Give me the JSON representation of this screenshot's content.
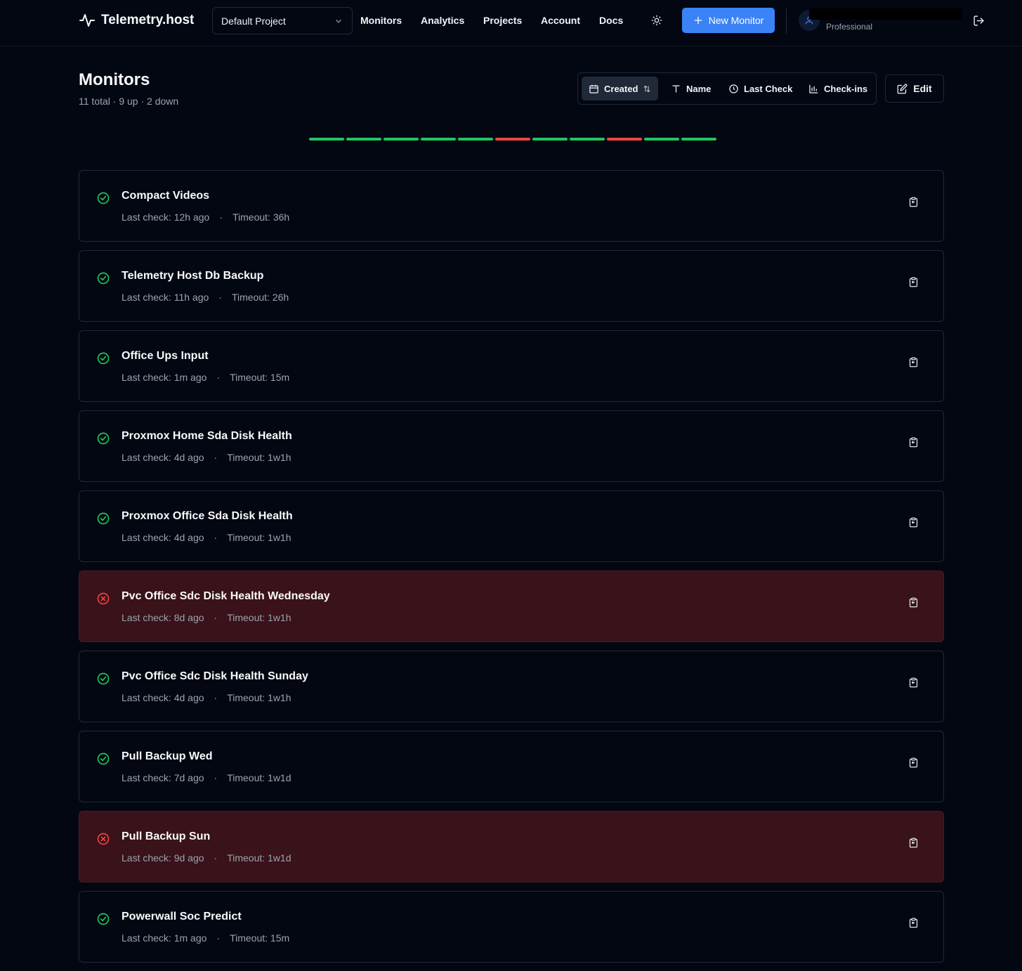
{
  "header": {
    "brand": "Telemetry.host",
    "project_select": "Default Project",
    "nav": [
      "Monitors",
      "Analytics",
      "Projects",
      "Account",
      "Docs"
    ],
    "new_monitor_label": "New Monitor",
    "plan": "Professional"
  },
  "page": {
    "title": "Monitors",
    "summary": "11 total · 9 up · 2 down"
  },
  "sort": {
    "options": [
      {
        "label": "Created",
        "icon": "calendar-icon",
        "active": true
      },
      {
        "label": "Name",
        "icon": "text-icon",
        "active": false
      },
      {
        "label": "Last Check",
        "icon": "clock-icon",
        "active": false
      },
      {
        "label": "Check-ins",
        "icon": "bar-chart-icon",
        "active": false
      }
    ],
    "edit_label": "Edit"
  },
  "colors": {
    "up": "#22c55e",
    "down": "#ef4444",
    "accent": "#3b82f6"
  },
  "status_strip": [
    "up",
    "up",
    "up",
    "up",
    "up",
    "down",
    "up",
    "up",
    "down",
    "up",
    "up"
  ],
  "monitors": [
    {
      "name": "Compact Videos",
      "status": "up",
      "last_check": "Last check: 12h ago",
      "timeout": "Timeout: 36h"
    },
    {
      "name": "Telemetry Host Db Backup",
      "status": "up",
      "last_check": "Last check: 11h ago",
      "timeout": "Timeout: 26h"
    },
    {
      "name": "Office Ups Input",
      "status": "up",
      "last_check": "Last check: 1m ago",
      "timeout": "Timeout: 15m"
    },
    {
      "name": "Proxmox Home Sda Disk Health",
      "status": "up",
      "last_check": "Last check: 4d ago",
      "timeout": "Timeout: 1w1h"
    },
    {
      "name": "Proxmox Office Sda Disk Health",
      "status": "up",
      "last_check": "Last check: 4d ago",
      "timeout": "Timeout: 1w1h"
    },
    {
      "name": "Pvc Office Sdc Disk Health Wednesday",
      "status": "down",
      "last_check": "Last check: 8d ago",
      "timeout": "Timeout: 1w1h"
    },
    {
      "name": "Pvc Office Sdc Disk Health Sunday",
      "status": "up",
      "last_check": "Last check: 4d ago",
      "timeout": "Timeout: 1w1h"
    },
    {
      "name": "Pull Backup Wed",
      "status": "up",
      "last_check": "Last check: 7d ago",
      "timeout": "Timeout: 1w1d"
    },
    {
      "name": "Pull Backup Sun",
      "status": "down",
      "last_check": "Last check: 9d ago",
      "timeout": "Timeout: 1w1d"
    },
    {
      "name": "Powerwall Soc Predict",
      "status": "up",
      "last_check": "Last check: 1m ago",
      "timeout": "Timeout: 15m"
    }
  ]
}
